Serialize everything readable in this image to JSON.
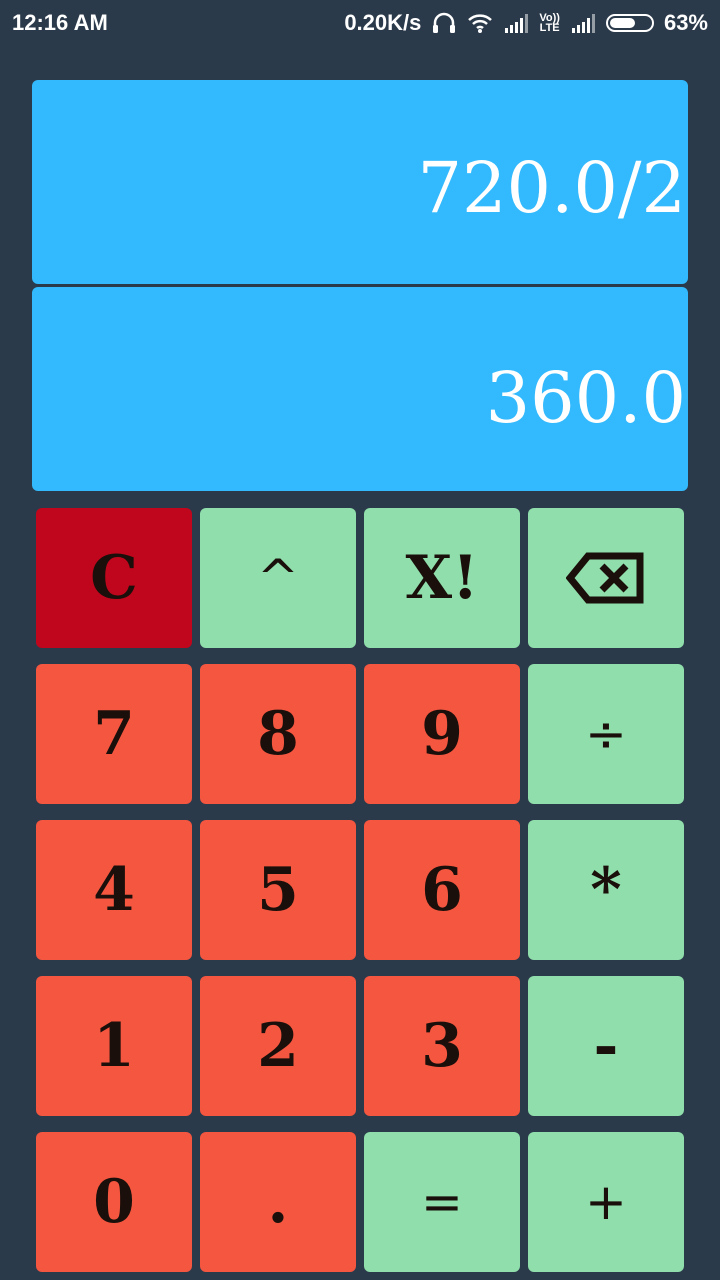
{
  "status_bar": {
    "time": "12:16 AM",
    "net_speed": "0.20K/s",
    "volte_top": "Vo))",
    "volte_bottom": "LTE",
    "battery_percent": "63%",
    "battery_level": 0.63,
    "icons": [
      "headphones-icon",
      "wifi-icon",
      "signal-icon",
      "volte-icon",
      "signal-icon",
      "battery-icon"
    ]
  },
  "display": {
    "expression": "720.0/2",
    "result": "360.0",
    "color": "#33b9fd"
  },
  "keys": {
    "clear": "C",
    "power": "^",
    "factorial": "X!",
    "backspace": "⌫",
    "seven": "7",
    "eight": "8",
    "nine": "9",
    "divide": "÷",
    "four": "4",
    "five": "5",
    "six": "6",
    "multiply": "*",
    "one": "1",
    "two": "2",
    "three": "3",
    "minus": "-",
    "zero": "0",
    "dot": ".",
    "equals": "=",
    "plus": "+"
  },
  "colors": {
    "background": "#2b3a4b",
    "number_key": "#f45640",
    "operator_key": "#8fdeab",
    "clear_key": "#c0061c"
  }
}
